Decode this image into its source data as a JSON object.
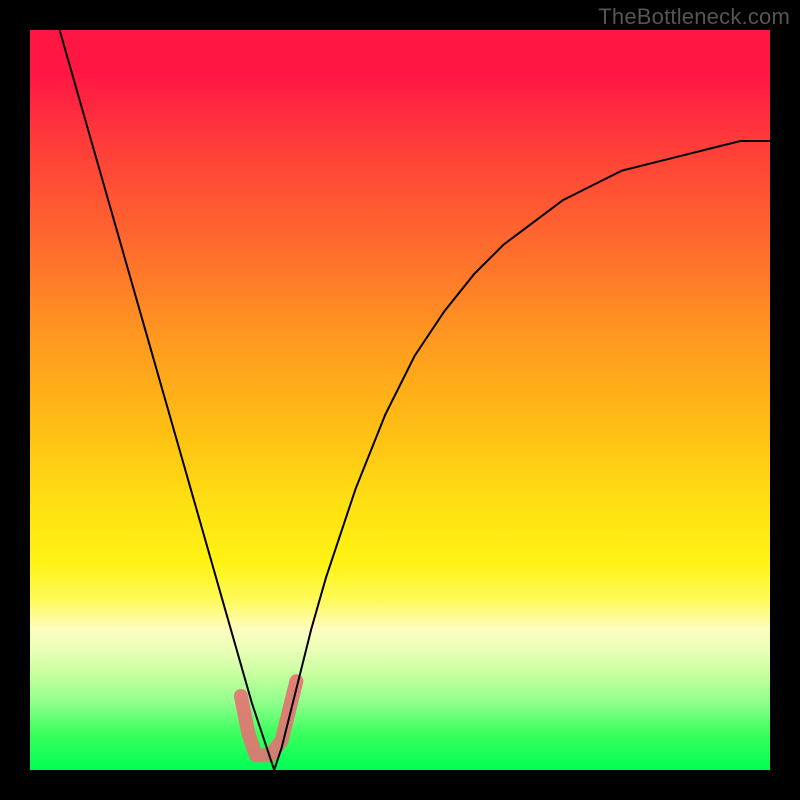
{
  "watermark": "TheBottleneck.com",
  "chart_data": {
    "type": "line",
    "title": "",
    "xlabel": "",
    "ylabel": "",
    "xlim": [
      0,
      100
    ],
    "ylim": [
      0,
      100
    ],
    "gradient_axis": "y",
    "gradient_stops": [
      {
        "pos": 0,
        "color": "#ff1744"
      },
      {
        "pos": 6,
        "color": "#ff1744"
      },
      {
        "pos": 15,
        "color": "#ff3b3a"
      },
      {
        "pos": 30,
        "color": "#ff6e2d"
      },
      {
        "pos": 42,
        "color": "#ff9a1f"
      },
      {
        "pos": 55,
        "color": "#ffc214"
      },
      {
        "pos": 64,
        "color": "#ffe013"
      },
      {
        "pos": 72,
        "color": "#fff314"
      },
      {
        "pos": 77,
        "color": "#fffa5a"
      },
      {
        "pos": 81,
        "color": "#fdfdc0"
      },
      {
        "pos": 84,
        "color": "#e8ffb5"
      },
      {
        "pos": 87,
        "color": "#c8ffa0"
      },
      {
        "pos": 91,
        "color": "#8dff8a"
      },
      {
        "pos": 95,
        "color": "#3cff5e"
      },
      {
        "pos": 100,
        "color": "#00ff55"
      }
    ],
    "series": [
      {
        "name": "bottleneck-curve",
        "stroke": "#000000",
        "stroke_width": 2,
        "x": [
          4,
          6,
          8,
          10,
          12,
          14,
          16,
          18,
          20,
          22,
          24,
          26,
          28,
          30,
          32,
          33,
          34,
          36,
          38,
          40,
          44,
          48,
          52,
          56,
          60,
          64,
          68,
          72,
          76,
          80,
          84,
          88,
          92,
          96,
          100
        ],
        "y": [
          100,
          93,
          86,
          79,
          72,
          65,
          58,
          51,
          44,
          37,
          30,
          23,
          16,
          9,
          3,
          0,
          3,
          11,
          19,
          26,
          38,
          48,
          56,
          62,
          67,
          71,
          74,
          77,
          79,
          81,
          82,
          83,
          84,
          85,
          85
        ]
      },
      {
        "name": "highlight-marker",
        "type": "marker",
        "stroke": "#e57373",
        "stroke_width": 14,
        "linecap": "round",
        "x": [
          28.5,
          29.5,
          30.5,
          32.5,
          34.0,
          35.0,
          36.0
        ],
        "y": [
          10,
          5,
          2,
          2,
          4,
          8,
          12
        ]
      }
    ],
    "minimum": {
      "x": 33,
      "y": 0
    }
  }
}
